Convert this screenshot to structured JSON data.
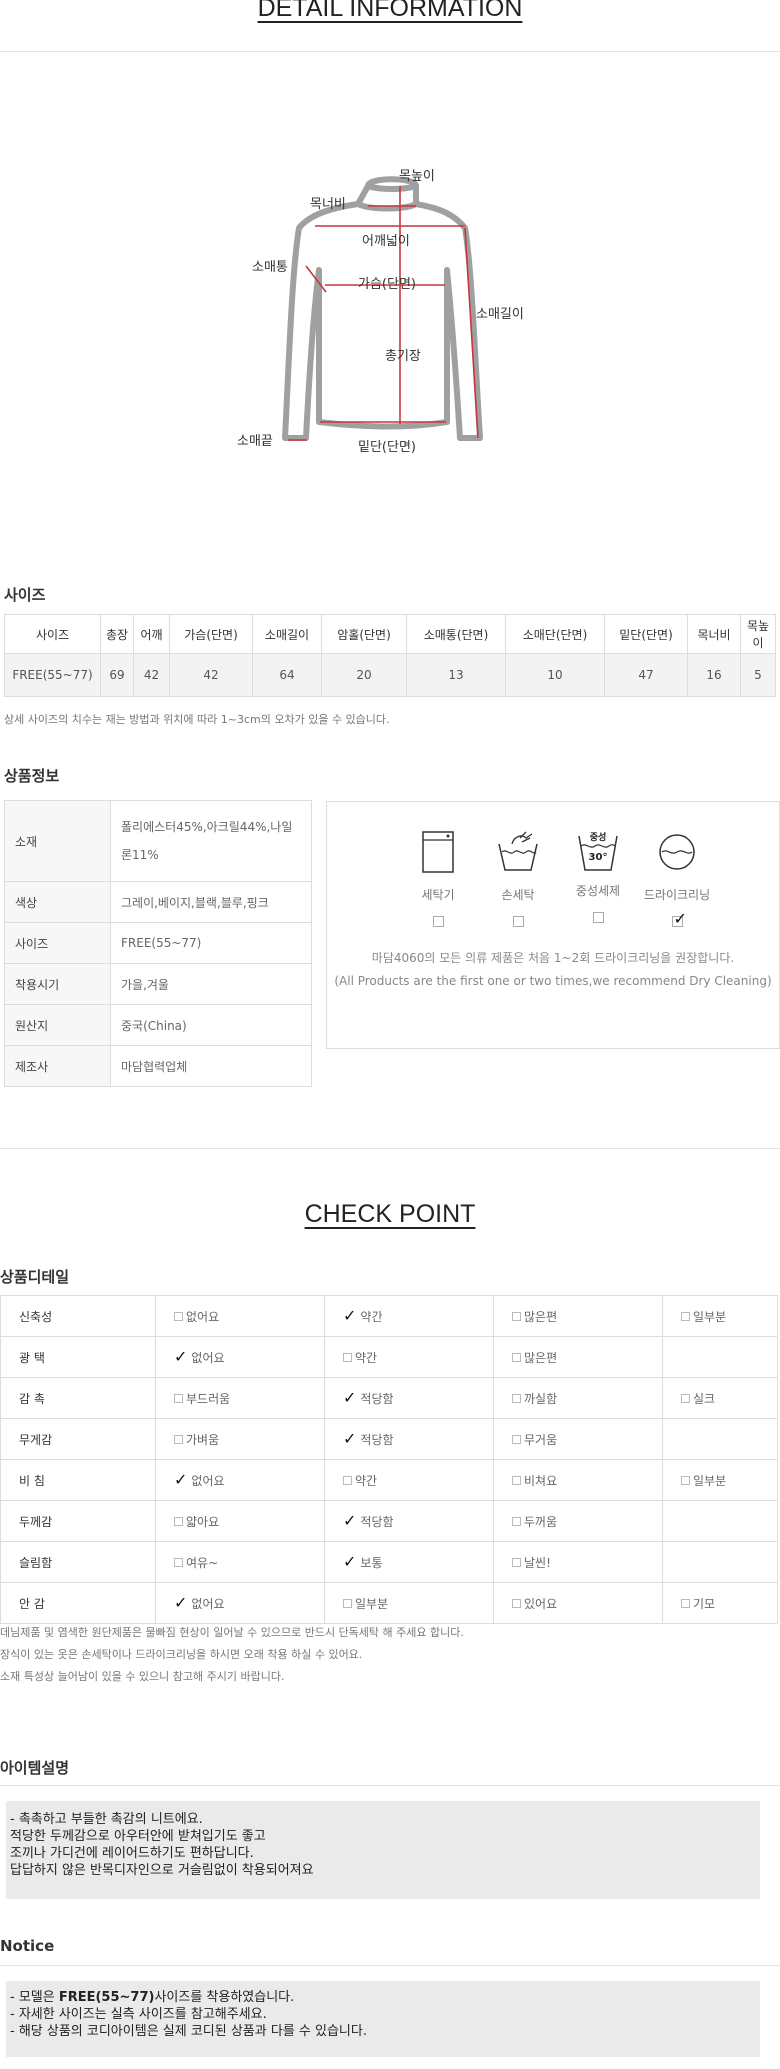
{
  "detail": {
    "title": "DETAIL INFORMATION",
    "labels": {
      "neck_height": "목높이",
      "neck_width": "목너비",
      "shoulder": "어깨넓이",
      "sleeve_width": "소매통",
      "chest": "가슴(단면)",
      "sleeve_length": "소매길이",
      "total_length": "총기장",
      "cuff": "소매끝",
      "hem": "밑단(단면)"
    }
  },
  "size": {
    "title": "사이즈",
    "headers": [
      "사이즈",
      "총장",
      "어깨",
      "가슴(단면)",
      "소매길이",
      "암홀(단면)",
      "소매통(단면)",
      "소매단(단면)",
      "밑단(단면)",
      "목너비",
      "목높이"
    ],
    "row": [
      "FREE(55~77)",
      "69",
      "42",
      "42",
      "64",
      "20",
      "13",
      "10",
      "47",
      "16",
      "5"
    ],
    "note": "상세 사이즈의 치수는 재는 방법과 위치에 따라 1~3cm의 오차가 있을 수 있습니다."
  },
  "product_info": {
    "title": "상품정보",
    "rows": [
      {
        "k": "소재",
        "v": "폴리에스터45%,아크릴44%,나일론11%"
      },
      {
        "k": "색상",
        "v": "그레이,베이지,블랙,블루,핑크"
      },
      {
        "k": "사이즈",
        "v": "FREE(55~77)"
      },
      {
        "k": "착용시기",
        "v": "가을,겨울"
      },
      {
        "k": "원산지",
        "v": "중국(China)"
      },
      {
        "k": "제조사",
        "v": "마담협력업체"
      }
    ]
  },
  "care": {
    "items": [
      {
        "label": "세탁기",
        "icon": "washing-machine-icon",
        "checked": false
      },
      {
        "label": "손세탁",
        "icon": "hand-wash-icon",
        "checked": false
      },
      {
        "label": "중성세제",
        "icon": "neutral-detergent-icon",
        "checked": false
      },
      {
        "label": "드라이크리닝",
        "icon": "dry-cleaning-icon",
        "checked": true
      }
    ],
    "wash_tub_text1": "중성",
    "wash_tub_text2": "30°",
    "note_ko": "마담4060의 모든 의류 제품은 처음 1~2회 드라이크리닝을 권장합니다.",
    "note_en": "(All Products are the first one or two times,we recommend Dry Cleaning)"
  },
  "check_point": {
    "title": "CHECK POINT",
    "subtitle": "상품디테일",
    "rows": [
      {
        "k": "신축성",
        "opts": [
          "없어요",
          "약간",
          "많은편",
          "일부분"
        ],
        "sel": 1
      },
      {
        "k": "광 택",
        "opts": [
          "없어요",
          "약간",
          "많은편",
          ""
        ],
        "sel": 0
      },
      {
        "k": "감 촉",
        "opts": [
          "부드러움",
          "적당함",
          "까실함",
          "실크"
        ],
        "sel": 1
      },
      {
        "k": "무게감",
        "opts": [
          "가벼움",
          "적당함",
          "무거움",
          ""
        ],
        "sel": 1
      },
      {
        "k": "비 침",
        "opts": [
          "없어요",
          "약간",
          "비쳐요",
          "일부분"
        ],
        "sel": 0
      },
      {
        "k": "두께감",
        "opts": [
          "얇아요",
          "적당함",
          "두꺼움",
          ""
        ],
        "sel": 1
      },
      {
        "k": "슬림함",
        "opts": [
          "여유~",
          "보통",
          "날씬!",
          ""
        ],
        "sel": 1
      },
      {
        "k": "안 감",
        "opts": [
          "없어요",
          "일부분",
          "있어요",
          "기모"
        ],
        "sel": 0
      }
    ],
    "notes": [
      "데님제품 및 염색한 원단제품은 물빠짐 현상이 일어날 수 있으므로 반드시 단독세탁 해 주세요 합니다.",
      "장식이 있는 옷은 손세탁이나 드라이크리닝을 하시면 오래 착용 하실 수 있어요.",
      "소재 특성상 늘어남이 있을 수 있으니 참고해 주시기 바랍니다."
    ]
  },
  "item_desc": {
    "title": "아이템설명",
    "lines": [
      "- 촉촉하고 부들한 촉감의 니트에요.",
      "적당한 두께감으로 아우터안에 받쳐입기도 좋고",
      "조끼나 가디건에 레이어드하기도 편하답니다.",
      "답답하지 않은 반목디자인으로 거슬림없이 착용되어져요"
    ]
  },
  "notice": {
    "title": "Notice",
    "line1_pre": "- 모델은 ",
    "line1_bold": "FREE(55~77)",
    "line1_post": "사이즈를 착용하였습니다.",
    "line2": "- 자세한 사이즈는 실측 사이즈를 참고해주세요.",
    "line3": "- 해당 상품의 코디아이템은 실제 코디된 상품과 다를 수 있습니다."
  }
}
